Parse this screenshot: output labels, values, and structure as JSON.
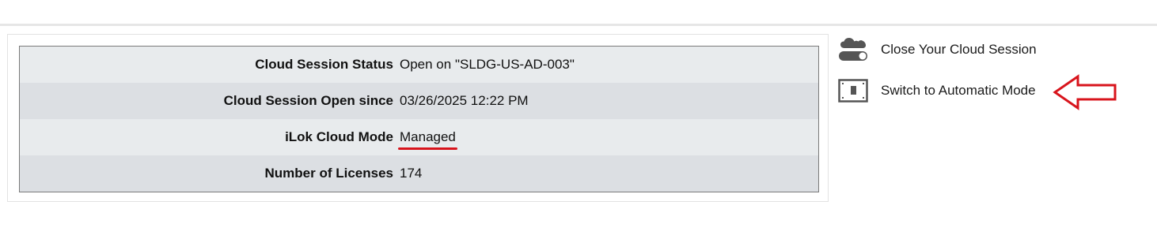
{
  "session_info": {
    "rows": [
      {
        "label": "Cloud Session Status",
        "value": "Open on \"SLDG-US-AD-003\""
      },
      {
        "label": "Cloud Session Open since",
        "value": "03/26/2025 12:22 PM"
      },
      {
        "label": "iLok Cloud Mode",
        "value": "Managed"
      },
      {
        "label": "Number of Licenses",
        "value": "174"
      }
    ]
  },
  "actions": {
    "close_session": {
      "label": "Close Your Cloud Session",
      "icon": "cloud-toggle-icon"
    },
    "switch_mode": {
      "label": "Switch to Automatic Mode",
      "icon": "switch-icon"
    }
  },
  "annotation_color": "#d8141c"
}
